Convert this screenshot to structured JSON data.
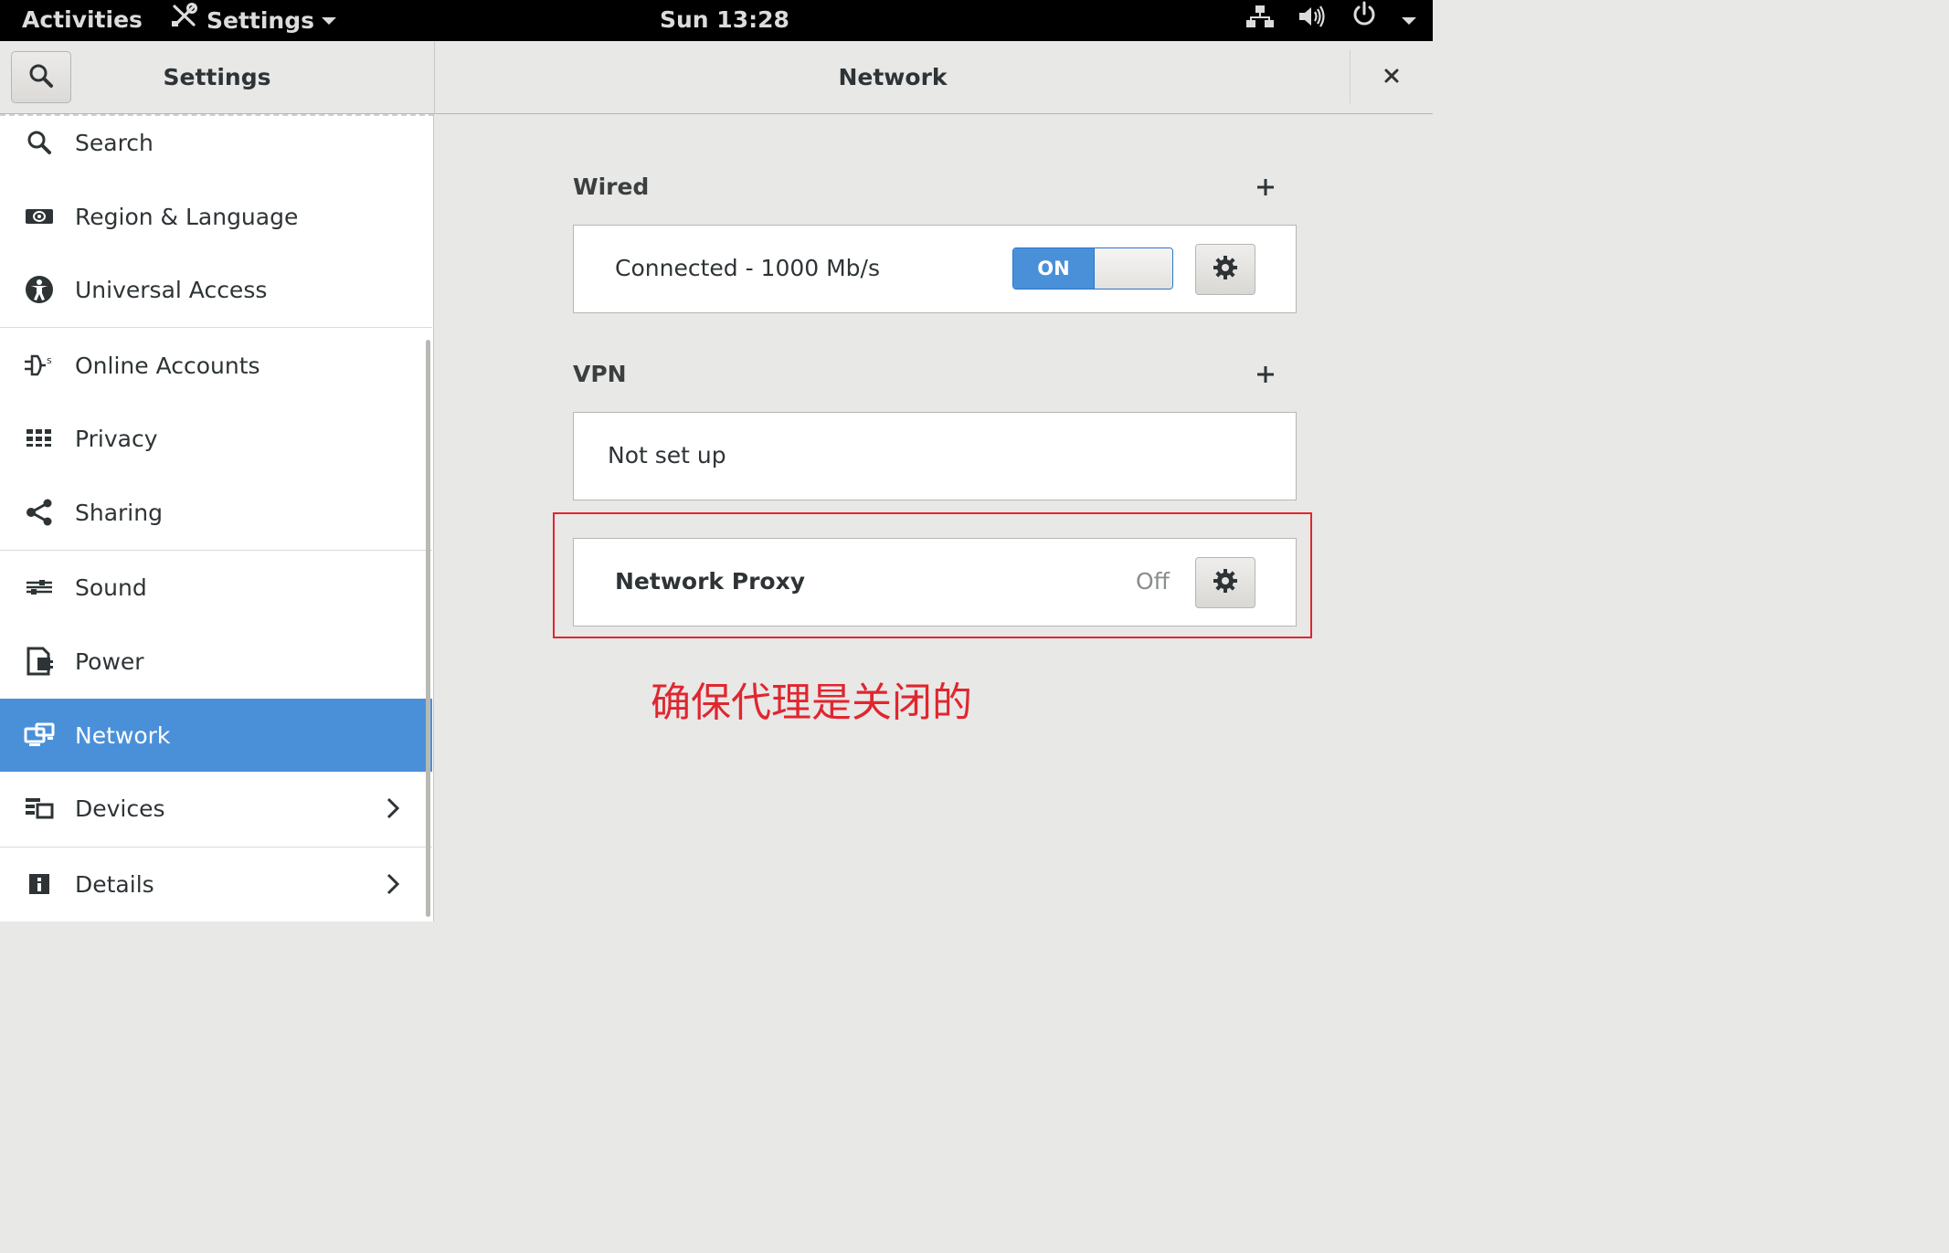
{
  "topbar": {
    "activities": "Activities",
    "app_menu": "Settings",
    "clock": "Sun 13:28"
  },
  "header": {
    "sidebar_title": "Settings",
    "page_title": "Network"
  },
  "sidebar": {
    "items": [
      {
        "label": "Search",
        "icon": "search-icon"
      },
      {
        "label": "Region & Language",
        "icon": "region-icon"
      },
      {
        "label": "Universal Access",
        "icon": "universal-access-icon"
      },
      {
        "label": "Online Accounts",
        "icon": "online-accounts-icon"
      },
      {
        "label": "Privacy",
        "icon": "privacy-icon"
      },
      {
        "label": "Sharing",
        "icon": "sharing-icon"
      },
      {
        "label": "Sound",
        "icon": "sound-icon"
      },
      {
        "label": "Power",
        "icon": "power-icon"
      },
      {
        "label": "Network",
        "icon": "network-icon",
        "selected": true
      },
      {
        "label": "Devices",
        "icon": "devices-icon",
        "has_submenu": true
      },
      {
        "label": "Details",
        "icon": "details-icon",
        "has_submenu": true
      }
    ]
  },
  "network": {
    "wired": {
      "title": "Wired",
      "status": "Connected - 1000 Mb/s",
      "switch_label": "ON"
    },
    "vpn": {
      "title": "VPN",
      "status": "Not set up"
    },
    "proxy": {
      "title": "Network Proxy",
      "status": "Off"
    }
  },
  "annotation": {
    "text": "确保代理是关闭的",
    "color": "#e0262f"
  },
  "colors": {
    "accent": "#4a90d9",
    "topbar": "#000000"
  }
}
